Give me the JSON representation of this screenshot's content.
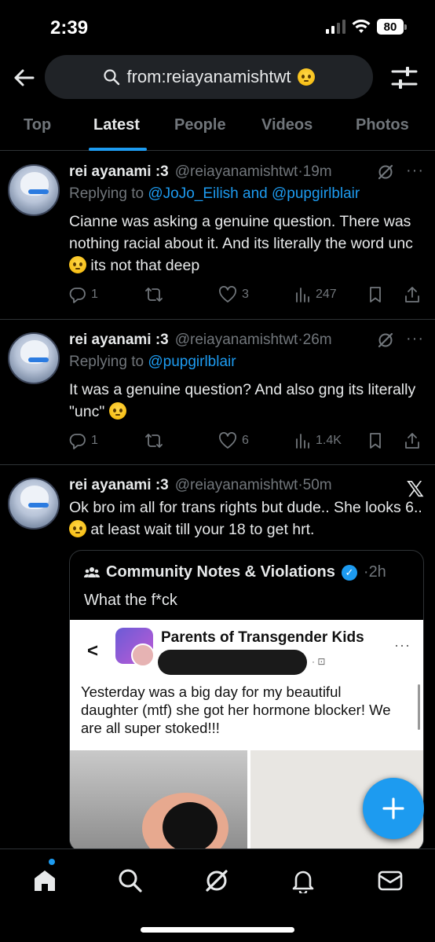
{
  "status": {
    "time": "2:39",
    "battery": "80"
  },
  "search": {
    "query": "from:reiayanamishtwt"
  },
  "tabs": [
    "Top",
    "Latest",
    "People",
    "Videos",
    "Photos"
  ],
  "tweets": [
    {
      "name": "rei ayanami :3",
      "handle": "@reiayanamishtwt",
      "time": "19m",
      "replying_prefix": "Replying to ",
      "replying_to": "@JoJo_Eilish and @pupgirlblair",
      "text_a": "Cianne was asking a genuine question. There was nothing racial about it. And its literally the word unc",
      "text_b": " its not that deep",
      "replies": "1",
      "reposts": "",
      "likes": "3",
      "views": "247"
    },
    {
      "name": "rei ayanami :3",
      "handle": "@reiayanamishtwt",
      "time": "26m",
      "replying_prefix": "Replying to ",
      "replying_to": "@pupgirlblair",
      "text_a": "It was a genuine question? And also gng its literally \"unc\" ",
      "text_b": "",
      "replies": "1",
      "reposts": "",
      "likes": "6",
      "views": "1.4K"
    },
    {
      "name": "rei ayanami :3",
      "handle": "@reiayanamishtwt",
      "time": "50m",
      "text_a": "Ok bro im all for trans rights but dude.. She looks 6..",
      "text_b": " at least wait till your 18 to get hrt.",
      "quote": {
        "name": "Community Notes & Violations",
        "time": "2h",
        "text": "What the f*ck",
        "image": {
          "group_title": "Parents of Transgender Kids",
          "post_text": "Yesterday was a big day for my beautiful daughter (mtf) she got her hormone blocker! We are all super stoked!!!"
        }
      }
    }
  ],
  "icons": {
    "back": "arrow-left-icon",
    "search": "search-icon",
    "filter": "sliders-icon",
    "grok": "grok-icon",
    "more": "more-icon",
    "x": "x-logo-icon",
    "reply": "reply-icon",
    "repost": "repost-icon",
    "like": "heart-icon",
    "views": "views-icon",
    "bookmark": "bookmark-icon",
    "share": "share-icon",
    "compose": "plus-icon",
    "home": "home-icon",
    "explore": "search-icon",
    "grok_nav": "grok-icon",
    "notifications": "bell-icon",
    "messages": "mail-icon"
  },
  "colors": {
    "accent": "#1d9bf0",
    "background": "#000000",
    "muted": "#71767b"
  }
}
